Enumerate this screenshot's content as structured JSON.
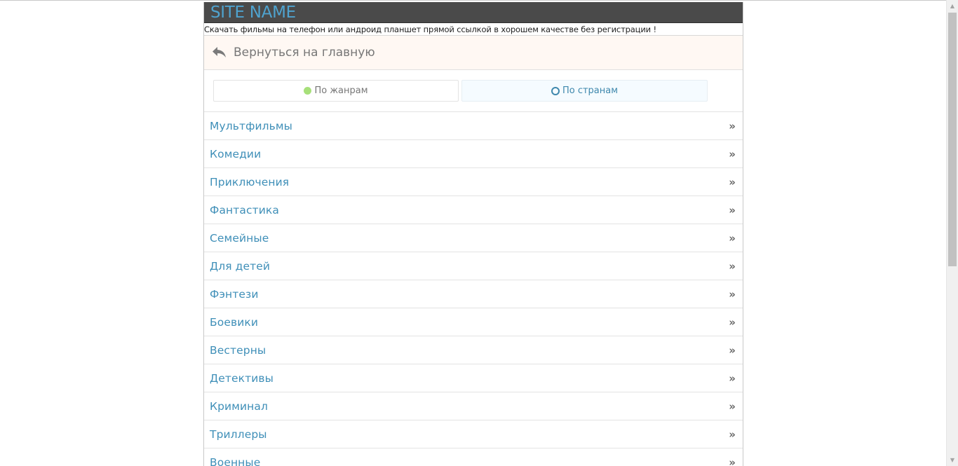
{
  "site": {
    "name": "SITE NAME",
    "tagline": "Скачать фильмы на телефон или андроид планшет прямой ссылкой в хорошем качестве без регистрации !"
  },
  "back": {
    "label": "Вернуться на главную",
    "icon": "reply-arrow-icon"
  },
  "filters": {
    "genres_label": "По жанрам",
    "countries_label": "По странам",
    "selected": "countries"
  },
  "categories": [
    {
      "label": "Мультфильмы"
    },
    {
      "label": "Комедии"
    },
    {
      "label": "Приключения"
    },
    {
      "label": "Фантастика"
    },
    {
      "label": "Семейные"
    },
    {
      "label": "Для детей"
    },
    {
      "label": "Фэнтези"
    },
    {
      "label": "Боевики"
    },
    {
      "label": "Вестерны"
    },
    {
      "label": "Детективы"
    },
    {
      "label": "Криминал"
    },
    {
      "label": "Триллеры"
    },
    {
      "label": "Военные"
    }
  ],
  "chevron": "»",
  "colors": {
    "header_bg": "#4a4a4a",
    "accent": "#3f8fb8",
    "back_bg": "#fff8f3",
    "genres_dot": "#a7e07a"
  }
}
